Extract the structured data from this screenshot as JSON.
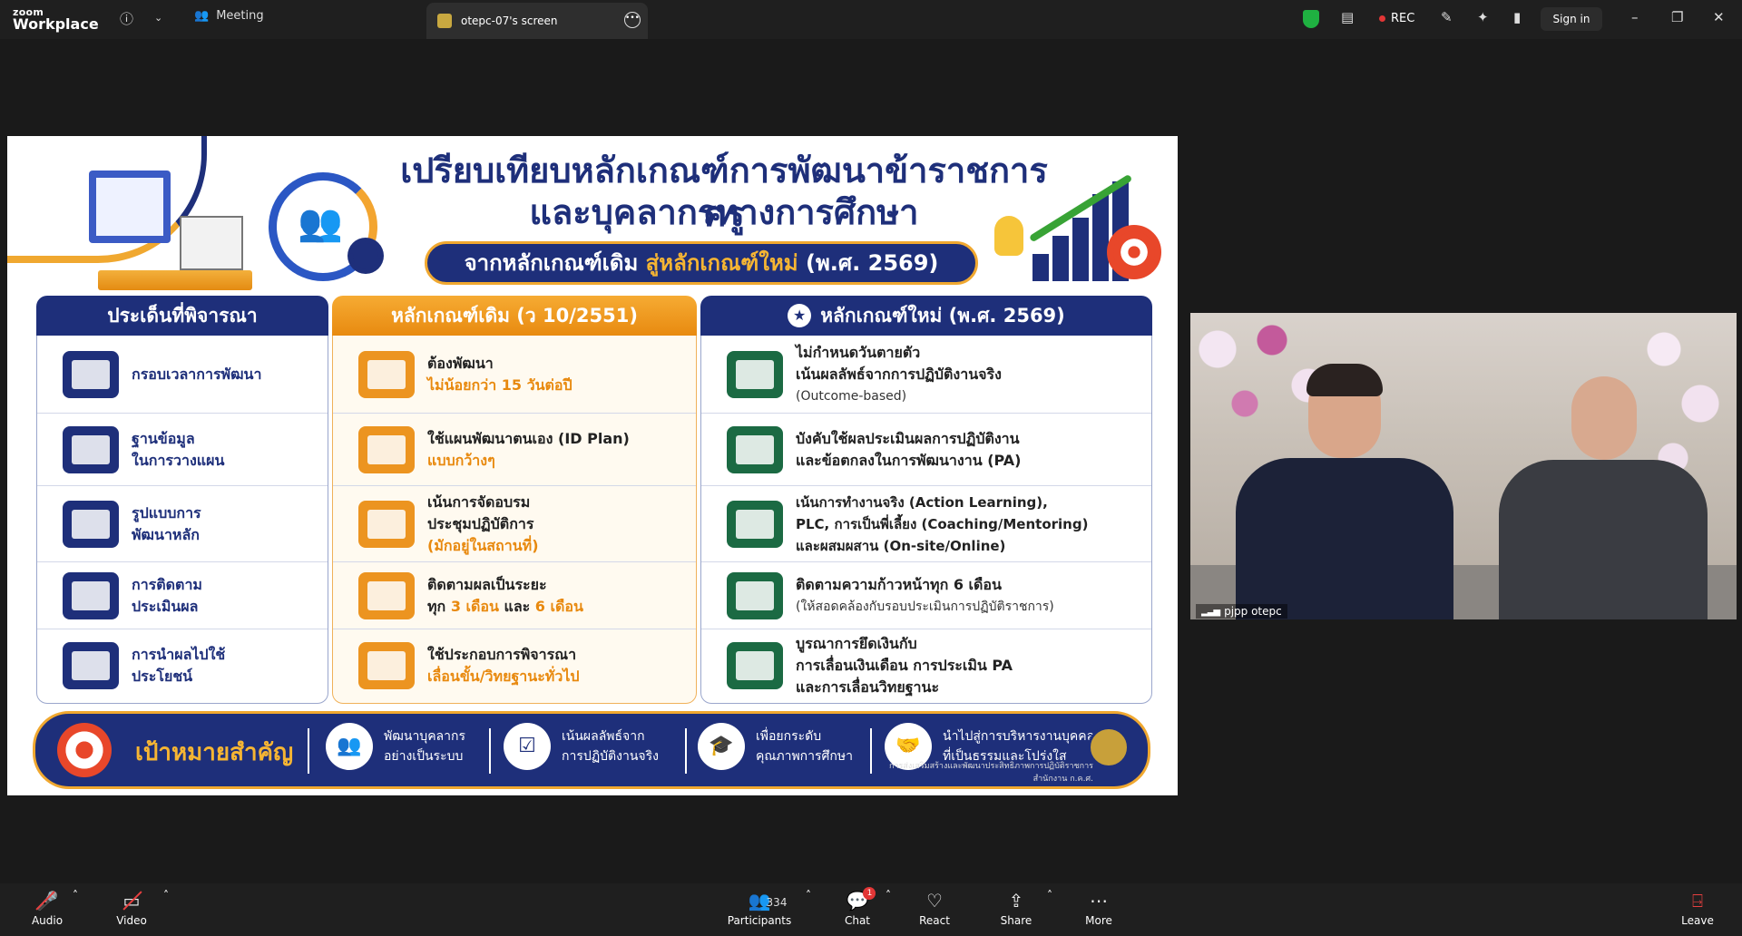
{
  "app": {
    "brand_line1": "zoom",
    "brand_line2": "Workplace"
  },
  "topbar": {
    "meeting_label": "Meeting",
    "screen_tab_label": "otepc-07's screen",
    "rec_label": "REC",
    "signin_label": "Sign in",
    "window": {
      "minimize": "–",
      "restore": "❐",
      "close": "✕"
    }
  },
  "slide": {
    "title_line1": "เปรียบเทียบหลักเกณฑ์การพัฒนาข้าราชการครู",
    "title_line2": "และบุคลากรทางการศึกษา",
    "subtitle_part1": "จากหลักเกณฑ์เดิม",
    "subtitle_part2": "สู่หลักเกณฑ์ใหม่",
    "subtitle_part3": "(พ.ศ. 2569)",
    "headers": [
      "ประเด็นที่พิจารณา",
      "หลักเกณฑ์เดิม (ว 10/2551)",
      "หลักเกณฑ์ใหม่ (พ.ศ. 2569)"
    ],
    "topics": [
      {
        "l1": "กรอบเวลาการพัฒนา",
        "l2": ""
      },
      {
        "l1": "ฐานข้อมูล",
        "l2": "ในการวางแผน"
      },
      {
        "l1": "รูปแบบการ",
        "l2": "พัฒนาหลัก"
      },
      {
        "l1": "การติดตาม",
        "l2": "ประเมินผล"
      },
      {
        "l1": "การนำผลไปใช้",
        "l2": "ประโยชน์"
      }
    ],
    "old": [
      {
        "l1": "ต้องพัฒนา",
        "l2": "ไม่น้อยกว่า 15 วันต่อปี",
        "l3": ""
      },
      {
        "l1": "ใช้แผนพัฒนาตนเอง (ID Plan)",
        "l2": "แบบกว้างๆ",
        "l3": ""
      },
      {
        "l1": "เน้นการจัดอบรม",
        "l2": "ประชุมปฏิบัติการ",
        "l3": "(มักอยู่ในสถานที่)"
      },
      {
        "l1": "ติดตามผลเป็นระยะ",
        "l2a": "ทุก",
        "l2b": "3 เดือน",
        "l2c": "และ",
        "l2d": "6 เดือน"
      },
      {
        "l1": "ใช้ประกอบการพิจารณา",
        "l2": "เลื่อนขั้น/วิทยฐานะทั่วไป",
        "l3": ""
      }
    ],
    "new": [
      {
        "l1": "ไม่กำหนดวันตายตัว",
        "l2": "เน้นผลลัพธ์จากการปฏิบัติงานจริง",
        "l3": "(Outcome-based)"
      },
      {
        "l1": "บังคับใช้ผลประเมินผลการปฏิบัติงาน",
        "l2": "และข้อตกลงในการพัฒนางาน (PA)",
        "l3": ""
      },
      {
        "l1": "เน้นการทำงานจริง (Action Learning),",
        "l2": "PLC, การเป็นพี่เลี้ยง (Coaching/Mentoring)",
        "l3": "และผสมผสาน (On-site/Online)"
      },
      {
        "l1": "ติดตามความก้าวหน้าทุก 6 เดือน",
        "l2": "(ให้สอดคล้องกับรอบประเมินการปฏิบัติราชการ)",
        "l3": ""
      },
      {
        "l1": "บูรณาการยึดเงินกับ",
        "l2": "การเลื่อนเงินเดือน การประเมิน PA",
        "l3": "และการเลื่อนวิทยฐานะ"
      }
    ],
    "goal_title": "เป้าหมายสำคัญ",
    "goals": [
      {
        "l1": "พัฒนาบุคลากร",
        "l2": "อย่างเป็นระบบ"
      },
      {
        "l1": "เน้นผลลัพธ์จาก",
        "l2": "การปฏิบัติงานจริง"
      },
      {
        "l1": "เพื่อยกระดับ",
        "l2": "คุณภาพการศึกษา"
      },
      {
        "l1": "นำไปสู่การบริหารงานบุคคล",
        "l2": "ที่เป็นธรรมและโปร่งใส"
      }
    ],
    "footnote_l1": "การส่งเสริมสร้างและพัฒนาประสิทธิภาพการปฏิบัติราชการ",
    "footnote_l2": "สำนักงาน ก.ค.ศ."
  },
  "video": {
    "participant_name": "pjpp otepc"
  },
  "toolbar": {
    "audio": "Audio",
    "video": "Video",
    "participants": "Participants",
    "participant_count": "334",
    "chat": "Chat",
    "chat_badge": "1",
    "react": "React",
    "share": "Share",
    "more": "More",
    "leave": "Leave"
  },
  "colors": {
    "navy": "#1e2f7a",
    "orange": "#e8890e",
    "green": "#1b6a43",
    "rec_red": "#e23636",
    "shield_green": "#1fb141"
  }
}
